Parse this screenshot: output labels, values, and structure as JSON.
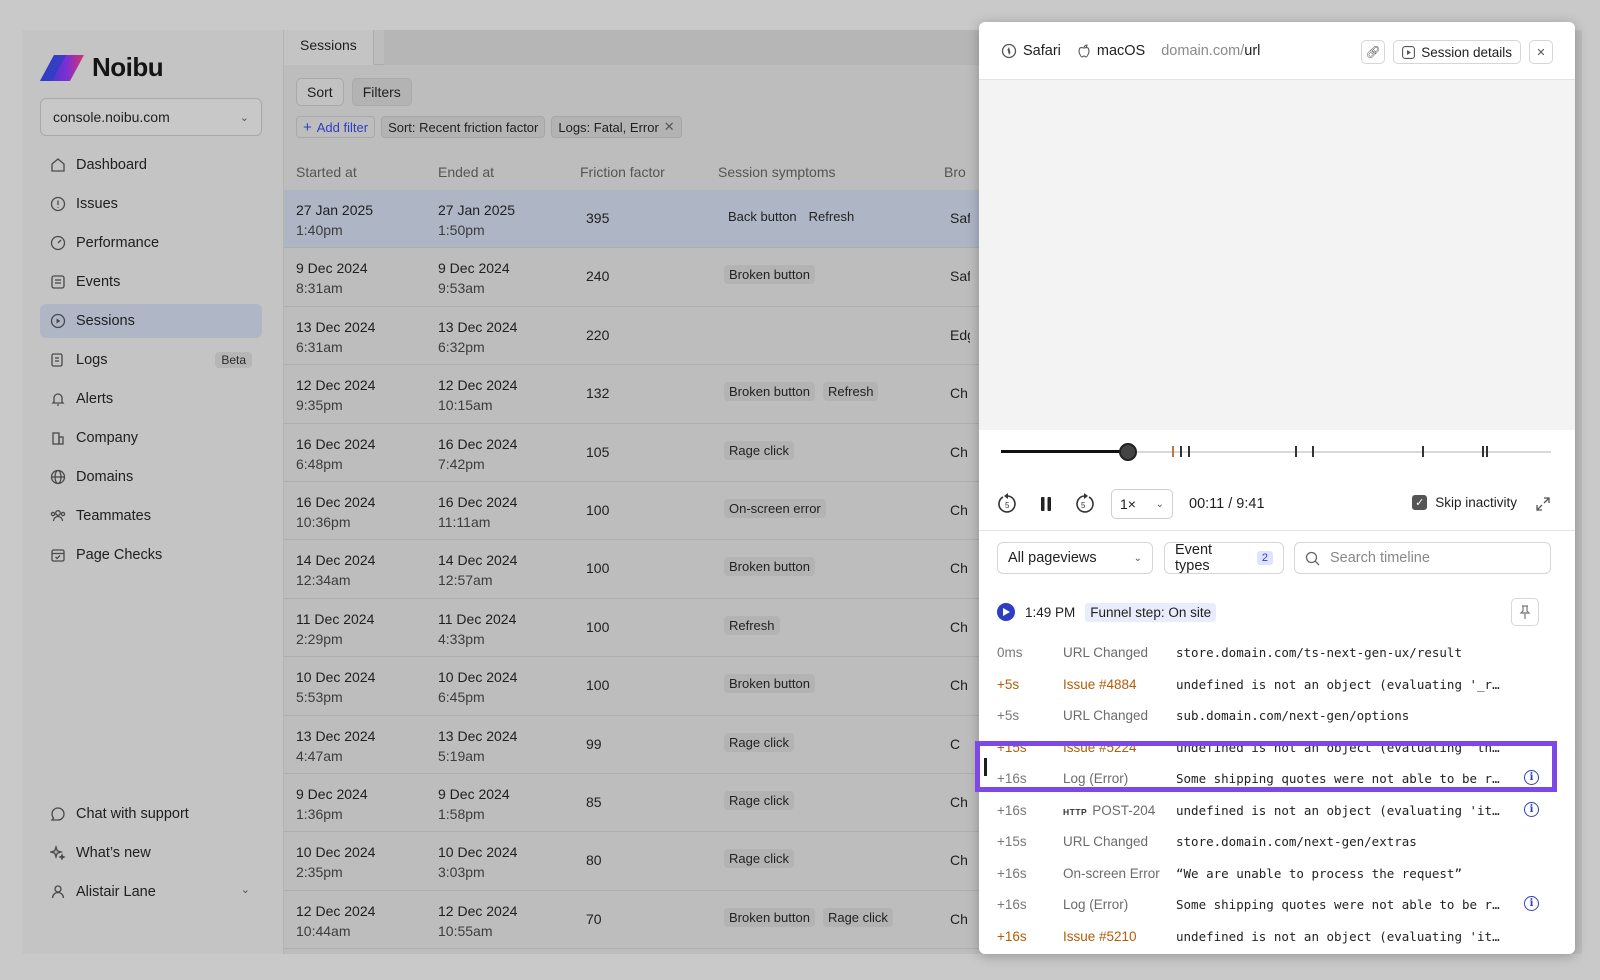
{
  "brand": {
    "name": "Noibu",
    "logo_colors": [
      "#2e3ec2",
      "#7a2fd6",
      "#d6336c"
    ]
  },
  "org_selector": {
    "value": "console.noibu.com"
  },
  "nav": {
    "items": [
      {
        "label": "Dashboard",
        "icon": "home-icon"
      },
      {
        "label": "Issues",
        "icon": "alert-circle-icon"
      },
      {
        "label": "Performance",
        "icon": "gauge-icon"
      },
      {
        "label": "Events",
        "icon": "list-icon"
      },
      {
        "label": "Sessions",
        "icon": "play-circle-icon",
        "active": true
      },
      {
        "label": "Logs",
        "icon": "logs-icon",
        "badge": "Beta"
      },
      {
        "label": "Alerts",
        "icon": "bell-icon"
      },
      {
        "label": "Company",
        "icon": "building-icon"
      },
      {
        "label": "Domains",
        "icon": "globe-icon"
      },
      {
        "label": "Teammates",
        "icon": "users-icon"
      },
      {
        "label": "Page Checks",
        "icon": "calendar-check-icon"
      }
    ],
    "bottom": [
      {
        "label": "Chat with support",
        "icon": "chat-icon"
      },
      {
        "label": "What’s new",
        "icon": "sparkle-icon"
      },
      {
        "label": "Alistair Lane",
        "icon": "user-icon"
      }
    ]
  },
  "main": {
    "tab": "Sessions",
    "sort_label": "Sort",
    "filters_label": "Filters",
    "add_filter": "Add filter",
    "chips": [
      "Sort: Recent friction factor",
      "Logs: Fatal, Error"
    ],
    "columns": [
      "Started at",
      "Ended at",
      "Friction factor",
      "Session symptoms",
      "Bro"
    ],
    "rows": [
      {
        "start_date": "27 Jan 2025",
        "start_time": "1:40pm",
        "end_date": "27 Jan 2025",
        "end_time": "1:50pm",
        "friction": "395",
        "symptoms": [
          "Back button",
          "Refresh"
        ],
        "plain": true,
        "browser": "Saf",
        "selected": true
      },
      {
        "start_date": "9 Dec 2024",
        "start_time": "8:31am",
        "end_date": "9 Dec 2024",
        "end_time": "9:53am",
        "friction": "240",
        "symptoms": [
          "Broken button"
        ],
        "browser": "Saf"
      },
      {
        "start_date": "13 Dec 2024",
        "start_time": "6:31am",
        "end_date": "13 Dec 2024",
        "end_time": "6:32pm",
        "friction": "220",
        "symptoms": [],
        "browser": "Edg"
      },
      {
        "start_date": "12 Dec 2024",
        "start_time": "9:35pm",
        "end_date": "12 Dec 2024",
        "end_time": "10:15am",
        "friction": "132",
        "symptoms": [
          "Broken button",
          "Refresh"
        ],
        "browser": "Ch"
      },
      {
        "start_date": "16 Dec 2024",
        "start_time": "6:48pm",
        "end_date": "16 Dec 2024",
        "end_time": "7:42pm",
        "friction": "105",
        "symptoms": [
          "Rage click"
        ],
        "browser": "Ch"
      },
      {
        "start_date": "16 Dec 2024",
        "start_time": "10:36pm",
        "end_date": "16 Dec 2024",
        "end_time": "11:11am",
        "friction": "100",
        "symptoms": [
          "On-screen error"
        ],
        "browser": "Ch"
      },
      {
        "start_date": "14 Dec 2024",
        "start_time": "12:34am",
        "end_date": "14 Dec 2024",
        "end_time": "12:57am",
        "friction": "100",
        "symptoms": [
          "Broken button"
        ],
        "browser": "Ch"
      },
      {
        "start_date": "11 Dec 2024",
        "start_time": "2:29pm",
        "end_date": "11 Dec 2024",
        "end_time": "4:33pm",
        "friction": "100",
        "symptoms": [
          "Refresh"
        ],
        "browser": "Ch"
      },
      {
        "start_date": "10 Dec 2024",
        "start_time": "5:53pm",
        "end_date": "10 Dec 2024",
        "end_time": "6:45pm",
        "friction": "100",
        "symptoms": [
          "Broken button"
        ],
        "browser": "Ch"
      },
      {
        "start_date": "13 Dec 2024",
        "start_time": "4:47am",
        "end_date": "13 Dec 2024",
        "end_time": "5:19am",
        "friction": "99",
        "symptoms": [
          "Rage click"
        ],
        "browser": "C"
      },
      {
        "start_date": "9 Dec 2024",
        "start_time": "1:36pm",
        "end_date": "9 Dec 2024",
        "end_time": "1:58pm",
        "friction": "85",
        "symptoms": [
          "Rage click"
        ],
        "browser": "Ch"
      },
      {
        "start_date": "10 Dec 2024",
        "start_time": "2:35pm",
        "end_date": "10 Dec 2024",
        "end_time": "3:03pm",
        "friction": "80",
        "symptoms": [
          "Rage click"
        ],
        "browser": "Ch"
      },
      {
        "start_date": "12 Dec 2024",
        "start_time": "10:44am",
        "end_date": "12 Dec 2024",
        "end_time": "10:55am",
        "friction": "70",
        "symptoms": [
          "Broken button",
          "Rage click"
        ],
        "browser": "Ch"
      }
    ]
  },
  "panel": {
    "browser": "Safari",
    "os": "macOS",
    "url_domain": "domain.com/",
    "url_path": "url",
    "session_details": "Session details",
    "progress": 0.23,
    "markers": [
      0.31,
      0.325,
      0.34,
      0.535,
      0.565,
      0.765,
      0.875,
      0.882
    ],
    "orange_markers": [
      0.31
    ],
    "speed": "1×",
    "time": "00:11 / 9:41",
    "skip_inactivity": "Skip inactivity",
    "pageviews": "All pageviews",
    "event_types": "Event types",
    "event_types_count": "2",
    "search_placeholder": "Search timeline",
    "funnel_time": "1:49 PM",
    "funnel_label": "Funnel step: On site",
    "accent": "#2e3ec2",
    "highlight_color": "#7d48e8",
    "timeline": [
      {
        "t": "0ms",
        "type": "URL Changed",
        "desc": "store.domain.com/ts-next-gen-ux/result"
      },
      {
        "t": "+5s",
        "type": "Issue #4884",
        "desc": "undefined is not an object (evaluating '_r…",
        "issue": true
      },
      {
        "t": "+5s",
        "type": "URL Changed",
        "desc": "sub.domain.com/next-gen/options"
      },
      {
        "t": "+15s",
        "type": "Issue #5224",
        "desc": "undefined is not an object (evaluating 'th…",
        "issue": true
      },
      {
        "t": "+16s",
        "type": "Log (Error)",
        "desc": "Some shipping quotes were not able to be r…",
        "info": true
      },
      {
        "t": "+16s",
        "type": "POST-204",
        "http": "HTTP",
        "desc": "undefined is not an object (evaluating 'it…",
        "info": true
      },
      {
        "t": "+15s",
        "type": "URL Changed",
        "desc": "store.domain.com/next-gen/extras"
      },
      {
        "t": "+16s",
        "type": "On-screen Error",
        "desc": "“We are unable to process the request”"
      },
      {
        "t": "+16s",
        "type": "Log (Error)",
        "desc": "Some shipping quotes were not able to be r…",
        "info": true
      },
      {
        "t": "+16s",
        "type": "Issue #5210",
        "desc": "undefined is not an object (evaluating 'it…",
        "issue": true
      }
    ]
  }
}
